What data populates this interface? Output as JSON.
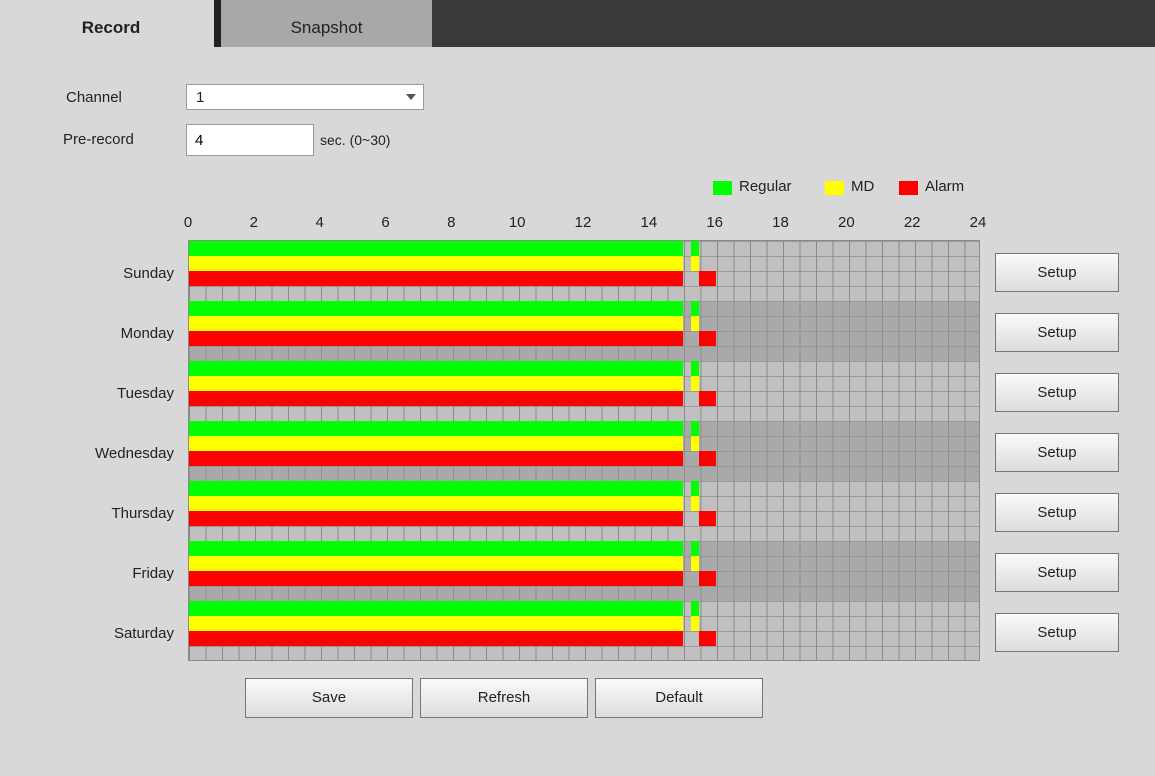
{
  "tabs": [
    {
      "label": "Record",
      "active": true
    },
    {
      "label": "Snapshot",
      "active": false
    }
  ],
  "channel": {
    "label": "Channel",
    "value": "1"
  },
  "prerecord": {
    "label": "Pre-record",
    "value": "4",
    "unit": "sec. (0~30)"
  },
  "legend": [
    {
      "label": "Regular",
      "color": "#00ff00"
    },
    {
      "label": "MD",
      "color": "#ffff00"
    },
    {
      "label": "Alarm",
      "color": "#ff0000"
    }
  ],
  "hour_labels": [
    "0",
    "2",
    "4",
    "6",
    "8",
    "10",
    "12",
    "14",
    "16",
    "18",
    "20",
    "22",
    "24"
  ],
  "schedule": {
    "days": [
      "Sunday",
      "Monday",
      "Tuesday",
      "Wednesday",
      "Thursday",
      "Friday",
      "Saturday"
    ],
    "regular": [
      [
        0,
        15
      ],
      [
        15.25,
        15.5
      ]
    ],
    "md": [
      [
        0,
        15
      ],
      [
        15.25,
        15.5
      ]
    ],
    "alarm": [
      [
        0,
        15
      ],
      [
        15.5,
        16
      ]
    ]
  },
  "setup_label": "Setup",
  "buttons": {
    "save": "Save",
    "refresh": "Refresh",
    "default": "Default"
  }
}
